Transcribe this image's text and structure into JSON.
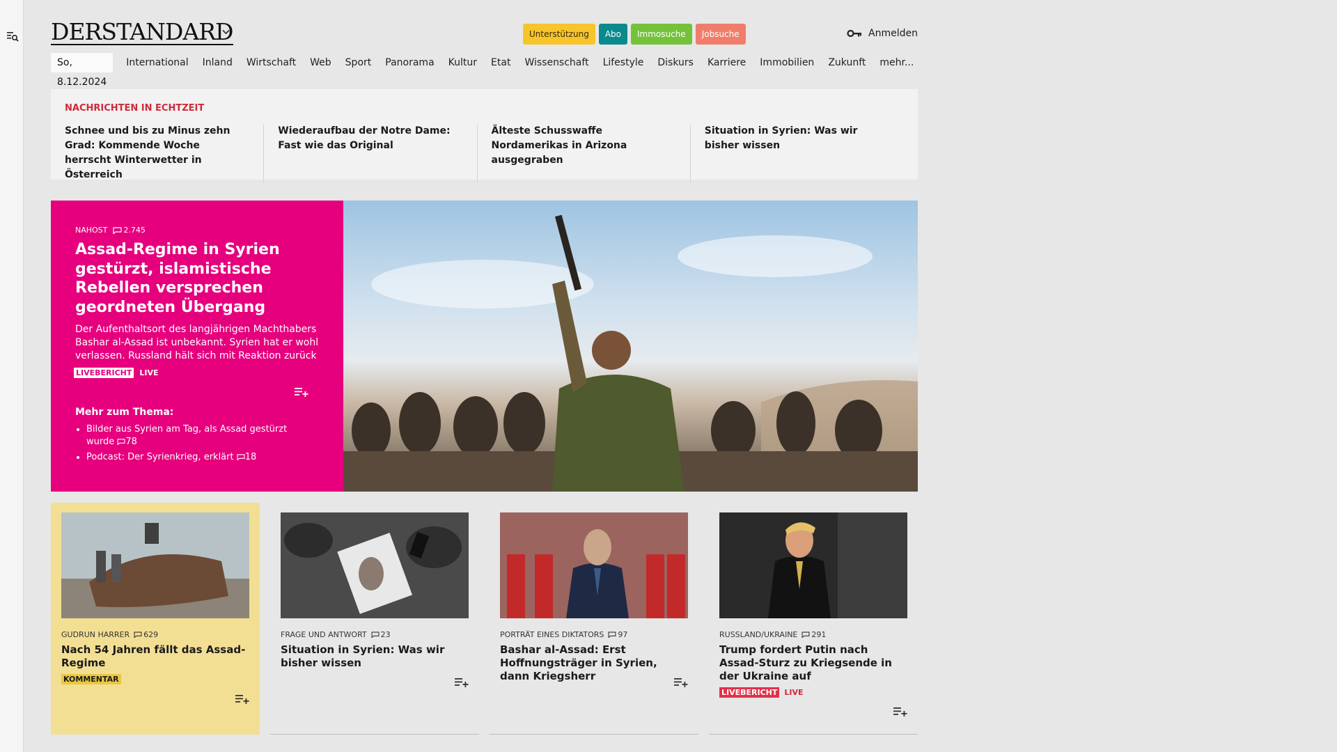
{
  "header": {
    "logo": "DERSTANDARD",
    "pills": {
      "support": "Unterstützung",
      "abo": "Abo",
      "immo": "Immosuche",
      "jobs": "Jobsuche"
    },
    "login": "Anmelden"
  },
  "nav": {
    "date": "So, 8.12.2024",
    "items": [
      "International",
      "Inland",
      "Wirtschaft",
      "Web",
      "Sport",
      "Panorama",
      "Kultur",
      "Etat",
      "Wissenschaft",
      "Lifestyle",
      "Diskurs",
      "Karriere",
      "Immobilien",
      "Zukunft",
      "mehr..."
    ]
  },
  "breaking": {
    "label": "NACHRICHTEN IN ECHTZEIT",
    "items": [
      "Schnee und bis zu Minus zehn Grad: Kommende Woche herrscht Winter­wetter in Österreich",
      "Wiederaufbau der Notre Dame: Fast wie das Original",
      "Älteste Schusswaffe Nordamerikas in Arizona ausgegraben",
      "Situation in Syrien: Was wir bisher wissen"
    ]
  },
  "hero": {
    "category": "NAHOST",
    "comments": "2.745",
    "title": "Assad-Regime in Syrien gestürzt, islamistische Rebellen versprechen geordneten Übergang",
    "lead": "Der Aufenthaltsort des langjährigen Machthabers Bashar al-Assad ist unbekannt. Syrien hat er wohl verlassen. Russland hält sich mit Reaktion zurück",
    "live_tag": "LIVEBERICHT",
    "live_label": "LIVE",
    "more_label": "Mehr zum Thema:",
    "more_items": [
      {
        "text": "Bilder aus Syrien am Tag, als Assad gestürzt wurde",
        "comments": "78"
      },
      {
        "text": "Podcast: Der Syrienkrieg, erklärt",
        "comments": "18"
      }
    ]
  },
  "cards": [
    {
      "kicker": "GUDRUN HARRER",
      "comments": "629",
      "title": "Nach 54 Jahren fällt das Assad-Regime",
      "tag": "KOMMENTAR"
    },
    {
      "kicker": "FRAGE UND ANTWORT",
      "comments": "23",
      "title": "Situation in Syrien: Was wir bisher wissen"
    },
    {
      "kicker": "PORTRÄT EINES DIKTATORS",
      "comments": "97",
      "title": "Bashar al-Assad: Erst Hoffnungs­träger in Syrien, dann Kriegsherr"
    },
    {
      "kicker": "RUSSLAND/UKRAINE",
      "comments": "291",
      "title": "Trump fordert Putin nach Assad-Sturz zu Kriegsende in der Ukraine auf",
      "live_tag": "LIVEBERICHT",
      "live_label": "LIVE"
    }
  ],
  "colors": {
    "hero_bg": "#e6007e",
    "breaking_red": "#cf2a3b",
    "opinion_bg": "#f3df94"
  }
}
